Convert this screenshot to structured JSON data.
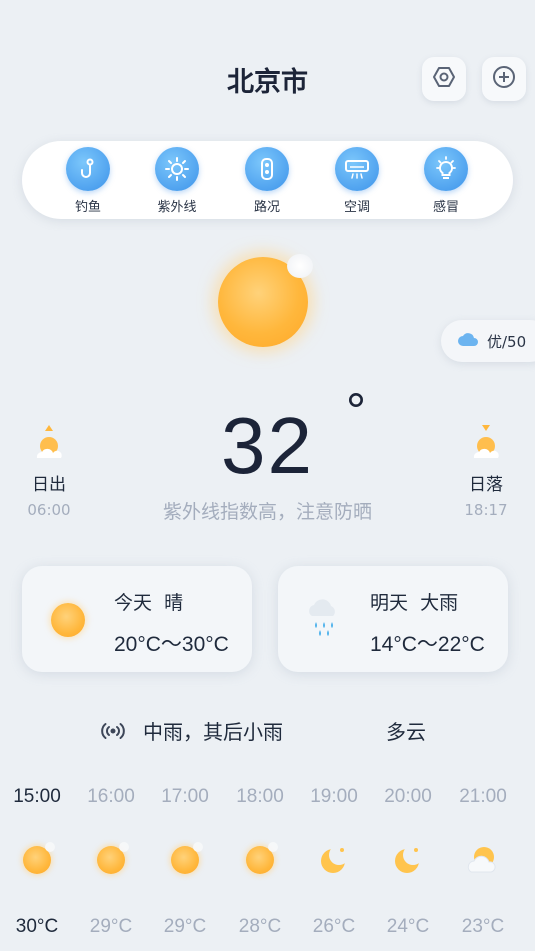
{
  "header": {
    "city": "北京市",
    "settings_icon": "settings-icon",
    "add_icon": "add-icon"
  },
  "quick_items": [
    {
      "label": "钓鱼",
      "icon": "fishing-hook-icon"
    },
    {
      "label": "紫外线",
      "icon": "uv-sun-icon"
    },
    {
      "label": "路况",
      "icon": "traffic-light-icon"
    },
    {
      "label": "空调",
      "icon": "air-conditioner-icon"
    },
    {
      "label": "感冒",
      "icon": "lightbulb-icon"
    }
  ],
  "current": {
    "temperature": "32",
    "degree_symbol": "°",
    "tip": "紫外线指数高，注意防晒",
    "aqi": "优/50",
    "colors": {
      "sun": "#ffb73c",
      "accent": "#3d93ea"
    }
  },
  "sunrise": {
    "label": "日出",
    "time": "06:00"
  },
  "sunset": {
    "label": "日落",
    "time": "18:17"
  },
  "days": [
    {
      "day": "今天",
      "weather": "晴",
      "range": "20°C～30°C",
      "icon": "sun-icon"
    },
    {
      "day": "明天",
      "weather": "大雨",
      "range": "14°C～22°C",
      "icon": "heavy-rain-icon"
    }
  ],
  "forecast": {
    "text": "中雨，其后小雨",
    "extra": "多云"
  },
  "hourly": [
    {
      "time": "15:00",
      "temp": "30°C",
      "icon": "sun-icon"
    },
    {
      "time": "16:00",
      "temp": "29°C",
      "icon": "sun-icon"
    },
    {
      "time": "17:00",
      "temp": "29°C",
      "icon": "sun-icon"
    },
    {
      "time": "18:00",
      "temp": "28°C",
      "icon": "sun-icon"
    },
    {
      "time": "19:00",
      "temp": "26°C",
      "icon": "moon-sun-icon"
    },
    {
      "time": "20:00",
      "temp": "24°C",
      "icon": "moon-sun-icon"
    },
    {
      "time": "21:00",
      "temp": "23°C",
      "icon": "partly-cloudy-icon"
    }
  ]
}
